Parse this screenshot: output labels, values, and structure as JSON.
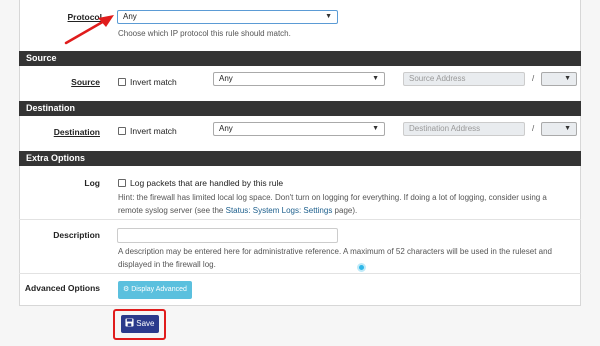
{
  "protocol": {
    "label": "Protocol",
    "value": "Any",
    "help": "Choose which IP protocol this rule should match."
  },
  "source": {
    "header": "Source",
    "label": "Source",
    "invert_label": "Invert match",
    "type_value": "Any",
    "address_placeholder": "Source Address",
    "slash": "/"
  },
  "destination": {
    "header": "Destination",
    "label": "Destination",
    "invert_label": "Invert match",
    "type_value": "Any",
    "address_placeholder": "Destination Address",
    "slash": "/"
  },
  "extra": {
    "header": "Extra Options",
    "log": {
      "label": "Log",
      "checkbox_label": "Log packets that are handled by this rule",
      "hint_line1": "Hint: the firewall has limited local log space. Don't turn on logging for everything. If doing a lot of logging, consider using a",
      "hint_line2_pre": "remote syslog server (see the ",
      "hint_link": "Status: System Logs: Settings",
      "hint_line2_post": " page)."
    },
    "description": {
      "label": "Description",
      "value": "",
      "help_line1": "A description may be entered here for administrative reference. A maximum of 52 characters will be used in the ruleset and",
      "help_line2": "displayed in the firewall log."
    },
    "advanced": {
      "label": "Advanced Options",
      "button": "Display Advanced"
    }
  },
  "save_button": "Save",
  "colors": {
    "section_bg": "#343434",
    "info_button": "#5bc0de",
    "save_button": "#2b3a8c",
    "highlight": "#e01c1c"
  }
}
